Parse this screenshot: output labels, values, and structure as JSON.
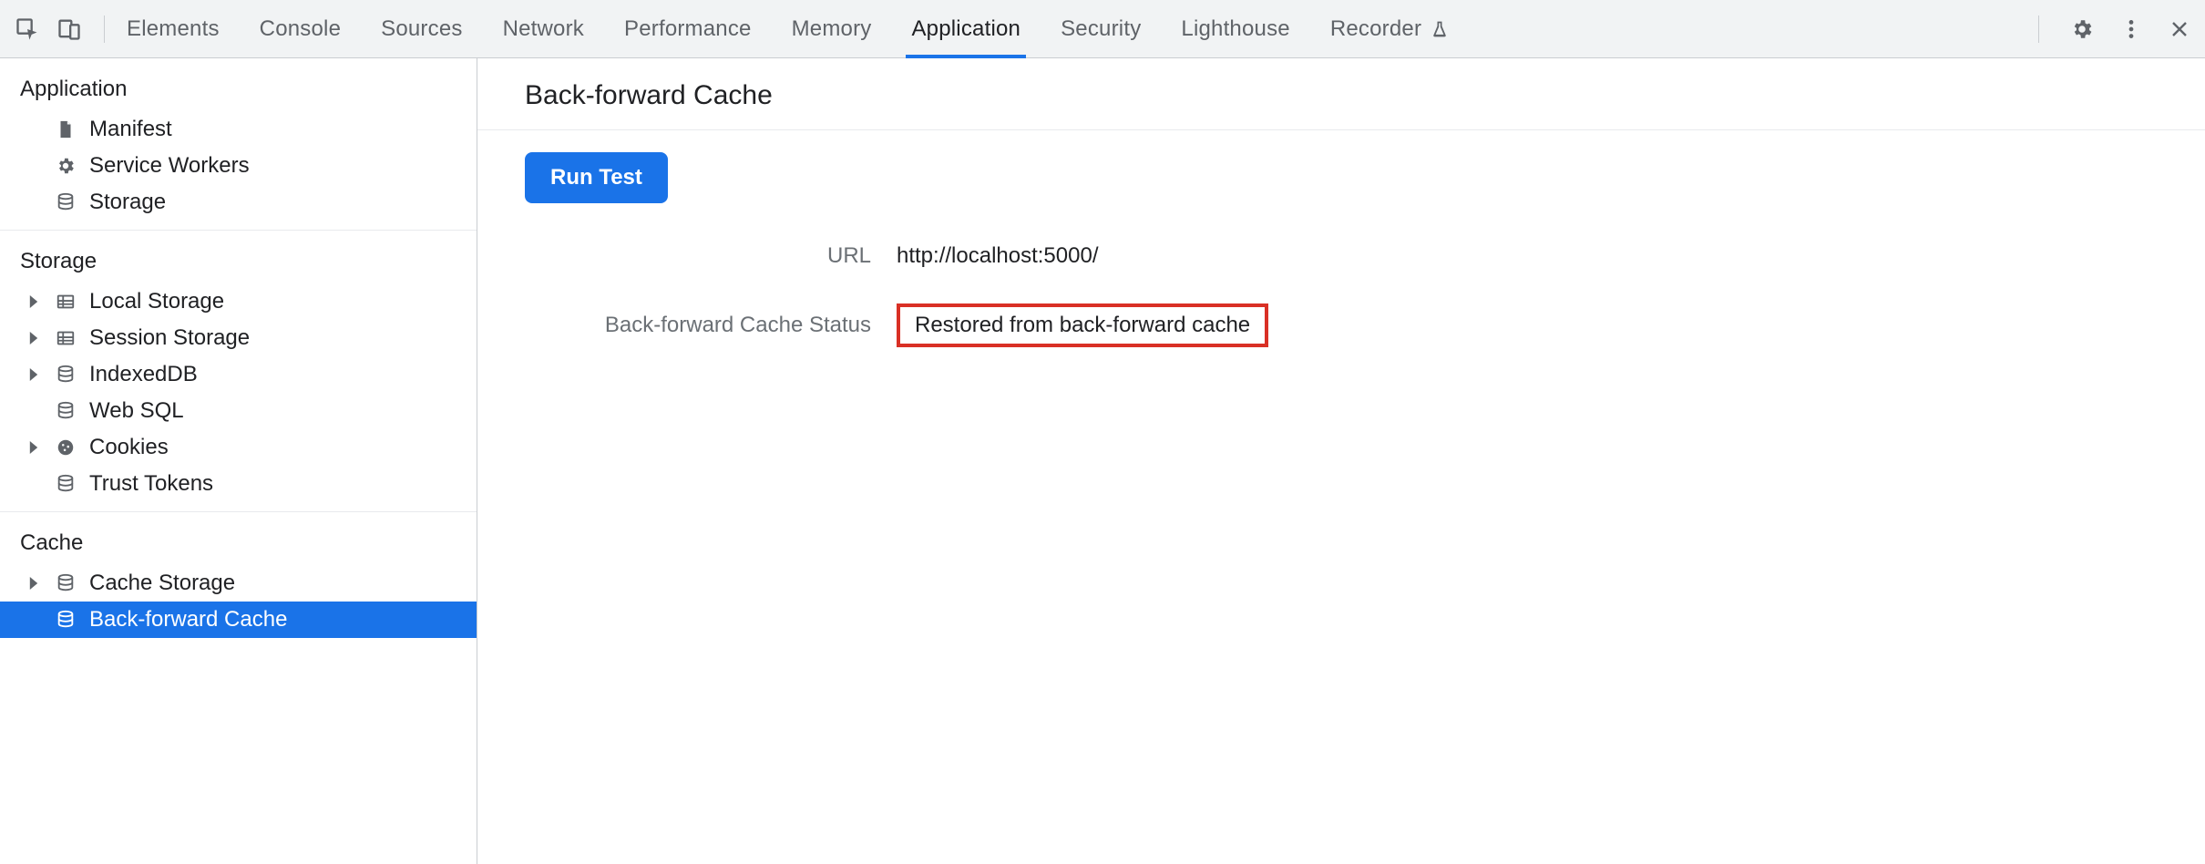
{
  "tabs": {
    "elements": "Elements",
    "console": "Console",
    "sources": "Sources",
    "network": "Network",
    "performance": "Performance",
    "memory": "Memory",
    "application": "Application",
    "security": "Security",
    "lighthouse": "Lighthouse",
    "recorder": "Recorder",
    "active": "application"
  },
  "sidebar": {
    "sections": {
      "application": {
        "title": "Application",
        "items": {
          "manifest": "Manifest",
          "service_workers": "Service Workers",
          "storage": "Storage"
        }
      },
      "storage": {
        "title": "Storage",
        "items": {
          "local_storage": "Local Storage",
          "session_storage": "Session Storage",
          "indexeddb": "IndexedDB",
          "web_sql": "Web SQL",
          "cookies": "Cookies",
          "trust_tokens": "Trust Tokens"
        }
      },
      "cache": {
        "title": "Cache",
        "items": {
          "cache_storage": "Cache Storage",
          "bf_cache": "Back-forward Cache"
        }
      }
    },
    "selected": "bf_cache"
  },
  "main": {
    "title": "Back-forward Cache",
    "run_test_label": "Run Test",
    "rows": {
      "url_label": "URL",
      "url_value": "http://localhost:5000/",
      "status_label": "Back-forward Cache Status",
      "status_value": "Restored from back-forward cache"
    }
  }
}
